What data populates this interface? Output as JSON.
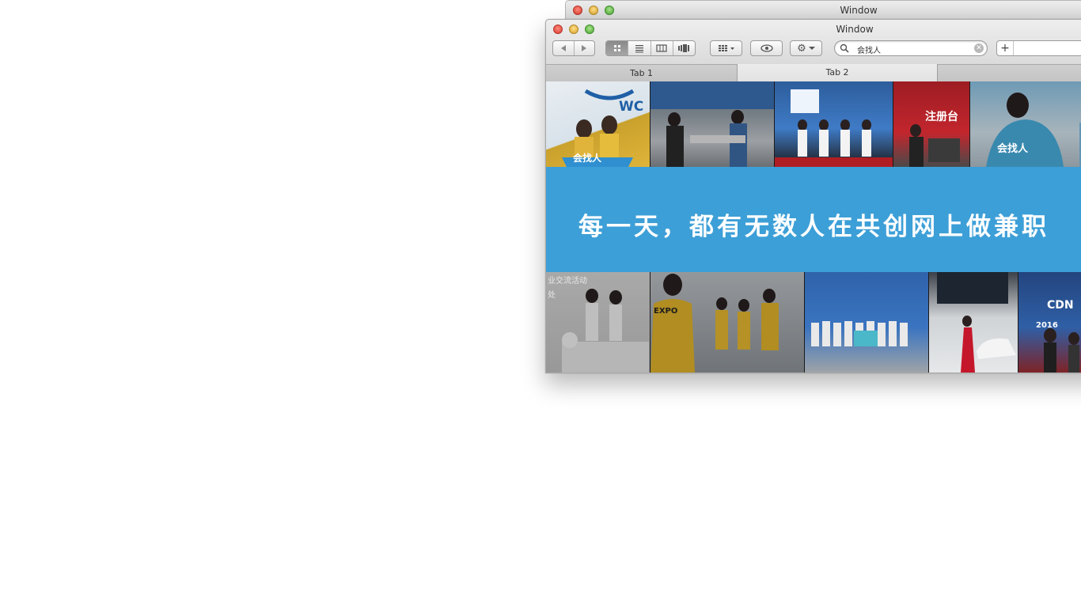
{
  "back_window": {
    "title": "Window"
  },
  "window": {
    "title": "Window",
    "search": {
      "value": "会找人",
      "clear_symbol": "✕"
    },
    "tabs": [
      {
        "label": "Tab 1"
      },
      {
        "label": "Tab 2"
      },
      {
        "label": ""
      }
    ],
    "add_symbol": "+"
  },
  "banner": {
    "slogan": "每一天，都有无数人在共创网上做兼职",
    "color": "#3d9fd7"
  },
  "photos": {
    "top": [
      {
        "caption": "WC",
        "sign": "会找人"
      },
      {
        "caption": ""
      },
      {
        "caption": ""
      },
      {
        "caption": "注册台"
      },
      {
        "caption": "会找人"
      }
    ],
    "bottom": [
      {
        "caption": "业交流活动",
        "caption2": "处"
      },
      {
        "caption": "EXPO"
      },
      {
        "caption": ""
      },
      {
        "caption": ""
      },
      {
        "caption": "CDN",
        "caption2": "2016"
      }
    ]
  },
  "icons": {
    "back": "back-arrow-icon",
    "forward": "forward-arrow-icon",
    "view_icon": "icon-view-icon",
    "view_list": "list-view-icon",
    "view_column": "column-view-icon",
    "view_cover": "coverflow-view-icon",
    "arrange": "arrange-menu-icon",
    "quicklook": "eye-icon",
    "action": "gear-icon",
    "search": "search-icon"
  }
}
